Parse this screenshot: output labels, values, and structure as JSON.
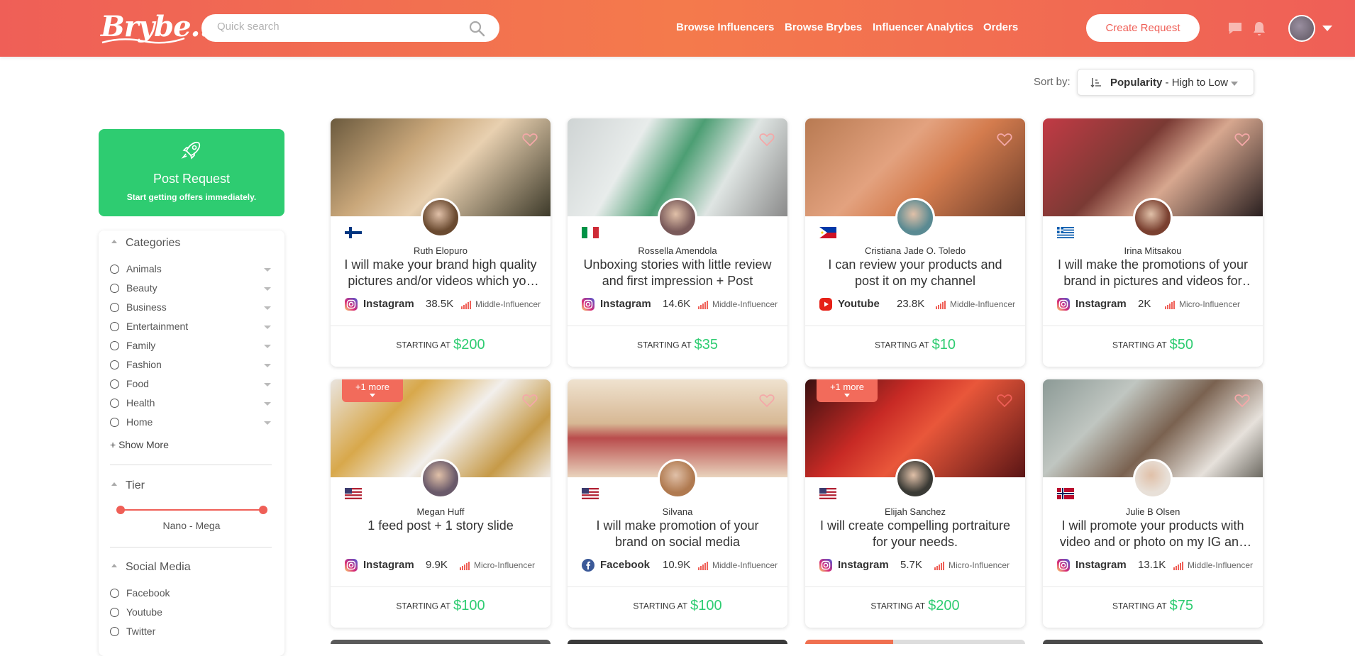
{
  "header": {
    "logo": "Brybe...",
    "search_placeholder": "Quick search",
    "nav": [
      "Browse Influencers",
      "Browse Brybes",
      "Influencer Analytics",
      "Orders"
    ],
    "create_request": "Create Request",
    "colors": {
      "brand_start": "#ef5f57",
      "brand_end": "#f47a4c",
      "accent_green": "#2ecc71"
    }
  },
  "sort": {
    "label": "Sort by:",
    "value_bold": "Popularity",
    "value_rest": " - High to Low"
  },
  "sidebar": {
    "post_request": {
      "title": "Post Request",
      "subtitle": "Start getting offers immediately."
    },
    "categories": {
      "title": "Categories",
      "items": [
        "Animals",
        "Beauty",
        "Business",
        "Entertainment",
        "Family",
        "Fashion",
        "Food",
        "Health",
        "Home"
      ],
      "show_more": "+ Show More"
    },
    "tier": {
      "title": "Tier",
      "range": "Nano - Mega",
      "min_fraction": 0,
      "max_fraction": 1
    },
    "social_media": {
      "title": "Social Media",
      "items": [
        "Facebook",
        "Youtube",
        "Twitter"
      ]
    }
  },
  "cards": [
    {
      "name": "Ruth Elopuro",
      "title": "I will make your brand high quality pictures and/or videos which you can use in your marketing",
      "platform": "Instagram",
      "followers": "38.5K",
      "tier": "Middle-Influencer",
      "price_label": "STARTING AT",
      "price": "$200",
      "flag": "finland",
      "more": ""
    },
    {
      "name": "Rossella Amendola",
      "title": "Unboxing stories with little review and first impression + Post",
      "platform": "Instagram",
      "followers": "14.6K",
      "tier": "Middle-Influencer",
      "price_label": "STARTING AT",
      "price": "$35",
      "flag": "italy",
      "more": ""
    },
    {
      "name": "Cristiana Jade O. Toledo",
      "title": "I can review your products and post it on my channel",
      "platform": "Youtube",
      "followers": "23.8K",
      "tier": "Middle-Influencer",
      "price_label": "STARTING AT",
      "price": "$10",
      "flag": "philippines",
      "more": ""
    },
    {
      "name": "Irina Mitsakou",
      "title": "I will make the promotions of your brand in pictures and videos for my followers",
      "platform": "Instagram",
      "followers": "2K",
      "tier": "Micro-Influencer",
      "price_label": "STARTING AT",
      "price": "$50",
      "flag": "greece",
      "more": ""
    },
    {
      "name": "Megan Huff",
      "title": "1 feed post + 1 story slide",
      "platform": "Instagram",
      "followers": "9.9K",
      "tier": "Micro-Influencer",
      "price_label": "STARTING AT",
      "price": "$100",
      "flag": "usa",
      "more": "+1 more"
    },
    {
      "name": "Silvana",
      "title": "I will make promotion of your brand on social media",
      "platform": "Facebook",
      "followers": "10.9K",
      "tier": "Middle-Influencer",
      "price_label": "STARTING AT",
      "price": "$100",
      "flag": "usa",
      "more": ""
    },
    {
      "name": "Elijah Sanchez",
      "title": "I will create compelling portraiture for your needs.",
      "platform": "Instagram",
      "followers": "5.7K",
      "tier": "Micro-Influencer",
      "price_label": "STARTING AT",
      "price": "$200",
      "flag": "usa",
      "more": "+1 more"
    },
    {
      "name": "Julie B Olsen",
      "title": "I will promote your products with video and or photo on my IG and facebook",
      "platform": "Instagram",
      "followers": "13.1K",
      "tier": "Middle-Influencer",
      "price_label": "STARTING AT",
      "price": "$75",
      "flag": "norway",
      "more": ""
    }
  ]
}
